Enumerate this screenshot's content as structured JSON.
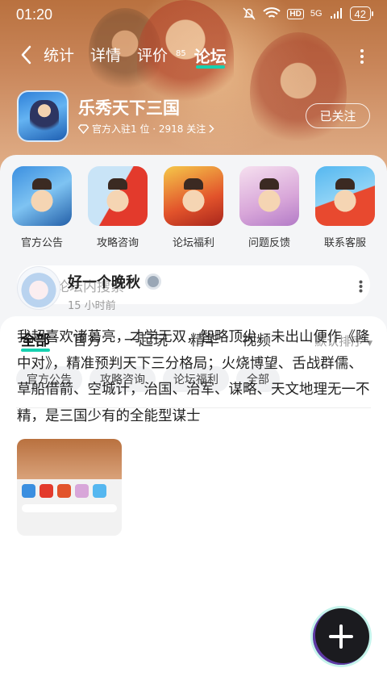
{
  "status_bar": {
    "time": "01:20",
    "network": "5G",
    "hd": "HD",
    "battery": "42"
  },
  "nav": {
    "tabs": [
      {
        "label": "统计"
      },
      {
        "label": "详情"
      },
      {
        "label": "评价",
        "badge": "85"
      },
      {
        "label": "论坛",
        "active": true
      }
    ]
  },
  "game": {
    "title": "乐秀天下三国",
    "meta": "官方入驻1 位 · 2918 关注",
    "follow_label": "已关注"
  },
  "shortcuts": [
    {
      "label": "官方公告"
    },
    {
      "label": "攻略咨询"
    },
    {
      "label": "论坛福利"
    },
    {
      "label": "问题反馈"
    },
    {
      "label": "联系客服"
    }
  ],
  "search": {
    "placeholder": "论坛内搜索"
  },
  "feed_tabs": [
    {
      "label": "全部",
      "active": true
    },
    {
      "label": "官方"
    },
    {
      "label": "一起玩"
    },
    {
      "label": "精华"
    },
    {
      "label": "视频"
    }
  ],
  "sort_label": "默认排序",
  "chips": [
    "官方公告",
    "攻略咨询",
    "论坛福利",
    "全部"
  ],
  "post": {
    "author": "好一个晚秋",
    "time": "15 小时前",
    "text": "我超喜欢诸葛亮，才学无双，智略顶尖，未出山便作《隆中对》，精准预判天下三分格局；火烧博望、舌战群儒、草船借箭、空城计，治国、治军、谋略、天文地理无一不精，是三国少有的全能型谋士"
  },
  "colors": {
    "accent": "#16d1b0",
    "hero_bg": "#c9865a"
  }
}
